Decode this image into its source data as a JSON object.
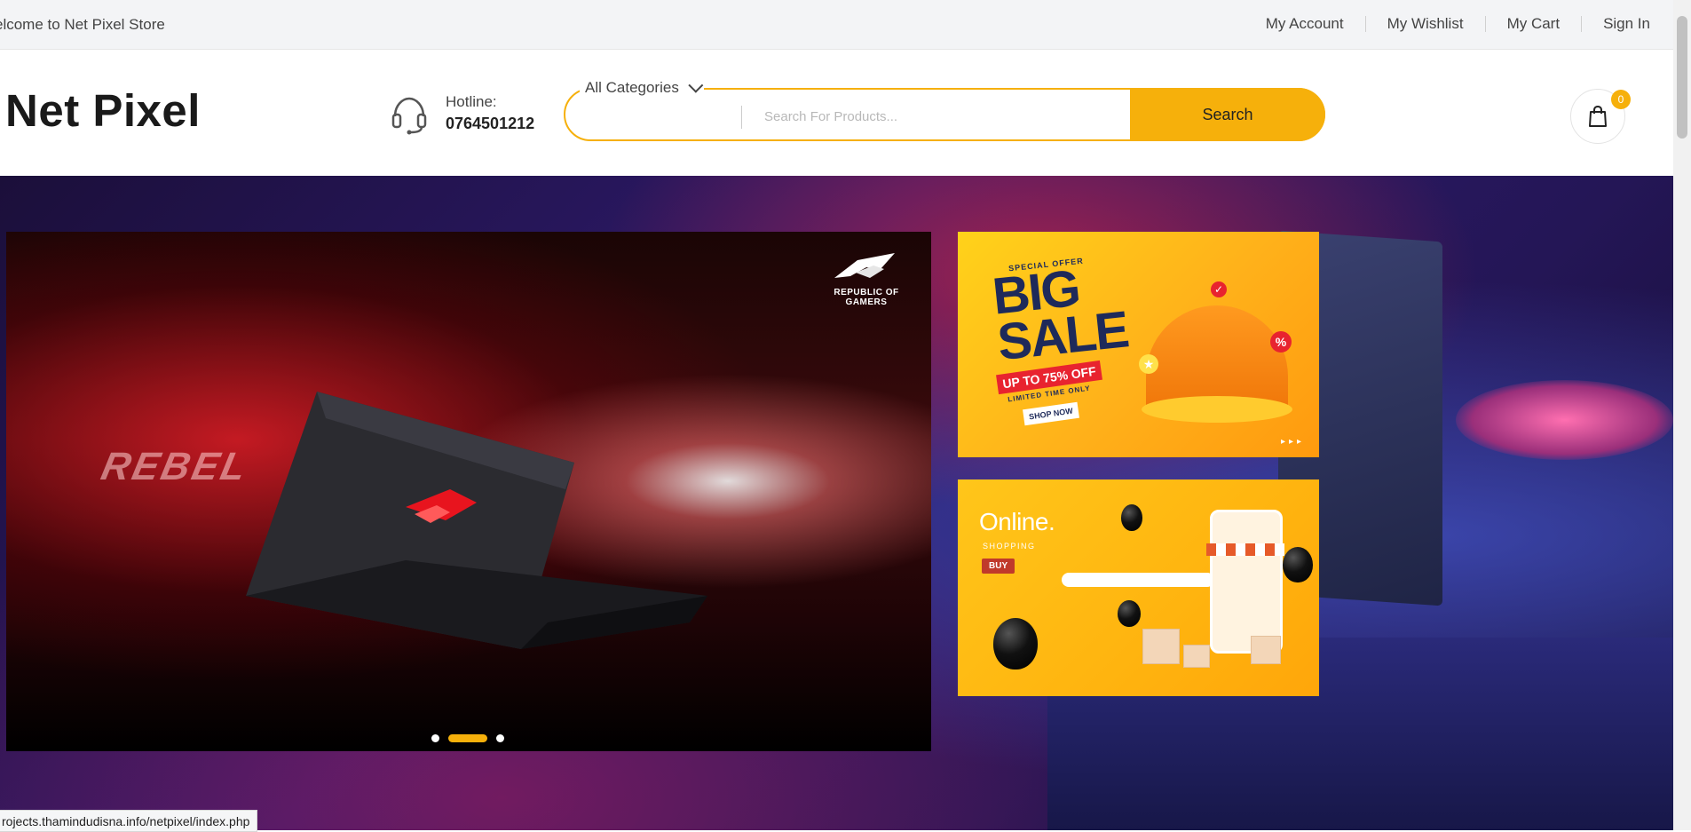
{
  "topbar": {
    "welcome": "elcome to Net Pixel Store",
    "links": [
      "My Account",
      "My Wishlist",
      "My Cart",
      "Sign In"
    ]
  },
  "header": {
    "logo": "Net Pixel",
    "hotline_label": "Hotline:",
    "hotline_number": "0764501212",
    "category_selected": "All Categories",
    "search_placeholder": "Search For Products...",
    "search_button": "Search",
    "cart_count": "0"
  },
  "hero": {
    "main_slide": {
      "rog_text": "REPUBLIC OF GAMERS",
      "rebel_text": "REBEL",
      "slide_count": 3,
      "active_slide": 2
    },
    "banner_sale": {
      "special_offer": "SPECIAL OFFER",
      "big": "BIG",
      "sale": "SALE",
      "discount": "UP TO 75% OFF",
      "limited": "LIMITED TIME ONLY",
      "shop_now": "SHOP NOW"
    },
    "banner_online": {
      "online": "Online.",
      "shopping": "SHOPPING",
      "buy": "BUY"
    }
  },
  "status_bar": {
    "url": "rojects.thamindudisna.info/netpixel/index.php"
  },
  "colors": {
    "accent": "#f6b00b",
    "hero_bg": "#2d1a6b"
  }
}
